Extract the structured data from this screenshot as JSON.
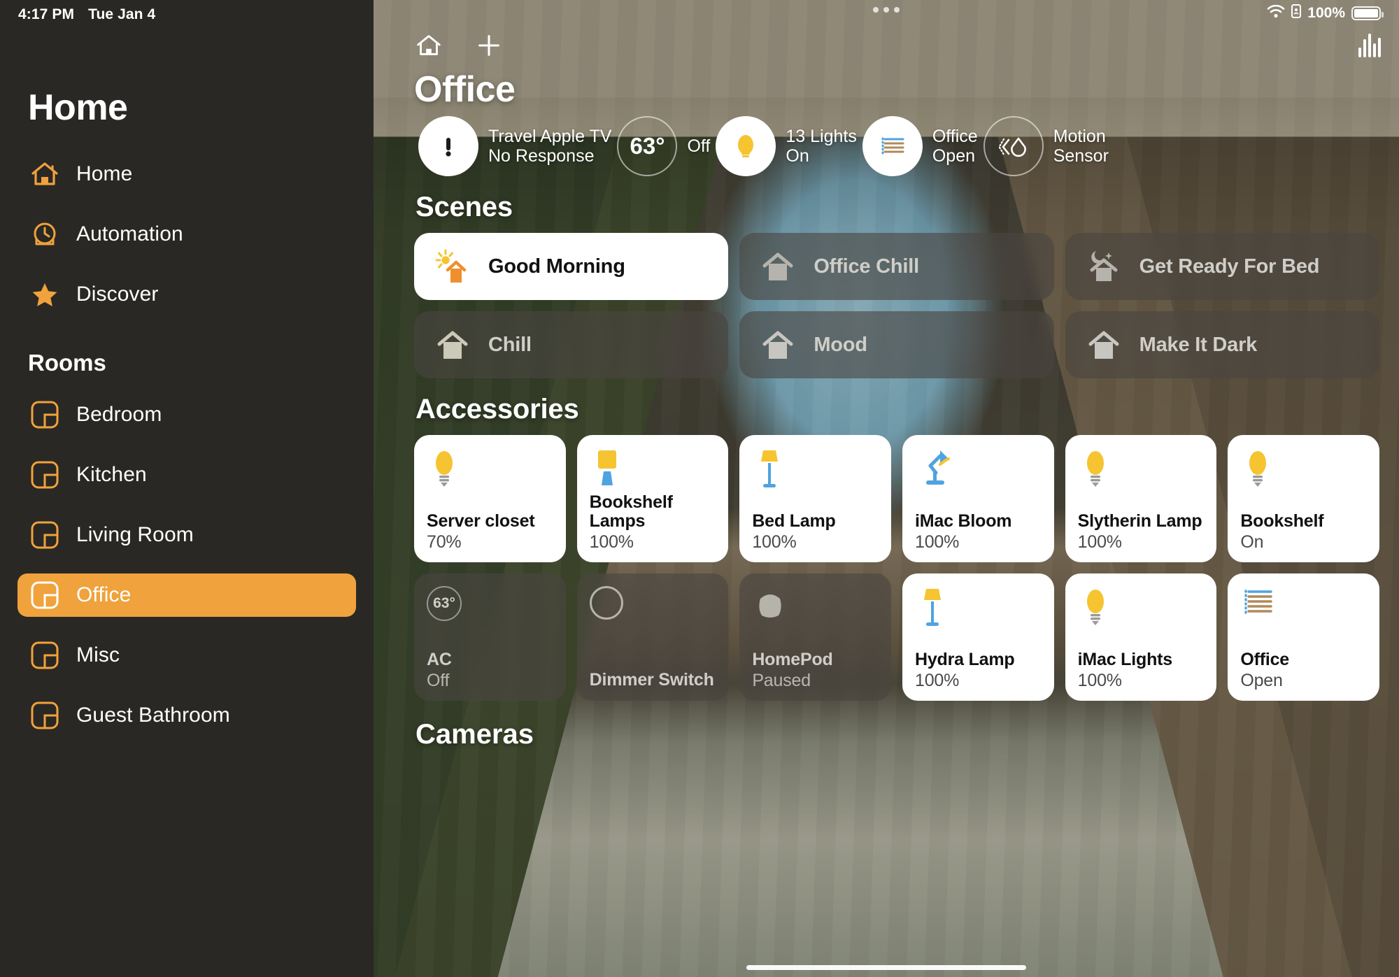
{
  "status_bar": {
    "time": "4:17 PM",
    "date": "Tue Jan 4",
    "battery_percent": "100%",
    "wifi_icon": "wifi-icon",
    "battery_icon": "battery-icon",
    "lock_icon": "portrait-lock-icon"
  },
  "sidebar": {
    "title": "Home",
    "primary": [
      {
        "label": "Home",
        "icon": "house-icon"
      },
      {
        "label": "Automation",
        "icon": "clock-icon"
      },
      {
        "label": "Discover",
        "icon": "star-icon"
      }
    ],
    "rooms_label": "Rooms",
    "rooms": [
      {
        "label": "Bedroom",
        "icon": "room-icon",
        "selected": false
      },
      {
        "label": "Kitchen",
        "icon": "room-icon",
        "selected": false
      },
      {
        "label": "Living Room",
        "icon": "room-icon",
        "selected": false
      },
      {
        "label": "Office",
        "icon": "room-icon",
        "selected": true
      },
      {
        "label": "Misc",
        "icon": "room-icon",
        "selected": false
      },
      {
        "label": "Guest Bathroom",
        "icon": "room-icon",
        "selected": false
      }
    ]
  },
  "main": {
    "home_button_icon": "house-icon",
    "add_button_icon": "plus-icon",
    "equalizer_icon": "audio-levels-icon",
    "room_title": "Office",
    "status_items": [
      {
        "icon": "exclamation-icon",
        "style": "filled",
        "line1": "Travel Apple TV",
        "line2": "No Response"
      },
      {
        "icon": "thermostat-icon",
        "style": "outline",
        "value": "63°",
        "line1": "Off",
        "line2": ""
      },
      {
        "icon": "lightbulb-icon",
        "style": "filled",
        "line1": "13 Lights",
        "line2": "On"
      },
      {
        "icon": "blinds-icon",
        "style": "filled",
        "line1": "Office",
        "line2": "Open"
      },
      {
        "icon": "motion-sensor-icon",
        "style": "outline",
        "line1": "Motion",
        "line2": "Sensor"
      }
    ],
    "scenes_title": "Scenes",
    "scenes": [
      {
        "label": "Good Morning",
        "icon": "sunrise-house-icon",
        "active": true
      },
      {
        "label": "Office Chill",
        "icon": "house-icon",
        "active": false
      },
      {
        "label": "Get Ready For Bed",
        "icon": "moon-house-icon",
        "active": false
      },
      {
        "label": "Chill",
        "icon": "house-icon",
        "active": false
      },
      {
        "label": "Mood",
        "icon": "house-icon",
        "active": false
      },
      {
        "label": "Make It Dark",
        "icon": "house-icon",
        "active": false
      }
    ],
    "accessories_title": "Accessories",
    "accessories": [
      {
        "name": "Server closet",
        "state": "70%",
        "icon": "lightbulb-icon",
        "on": true
      },
      {
        "name": "Bookshelf Lamps",
        "state": "100%",
        "icon": "table-lamp-icon",
        "on": true
      },
      {
        "name": "Bed Lamp",
        "state": "100%",
        "icon": "floor-lamp-icon",
        "on": true
      },
      {
        "name": "iMac Bloom",
        "state": "100%",
        "icon": "desk-lamp-icon",
        "on": true
      },
      {
        "name": "Slytherin Lamp",
        "state": "100%",
        "icon": "lightbulb-icon",
        "on": true
      },
      {
        "name": "Bookshelf",
        "state": "On",
        "icon": "lightbulb-icon",
        "on": true
      },
      {
        "name": "AC",
        "state": "Off",
        "icon": "thermostat-icon",
        "temp": "63°",
        "on": false
      },
      {
        "name": "Dimmer Switch",
        "state": "",
        "icon": "dimmer-switch-icon",
        "on": false
      },
      {
        "name": "HomePod",
        "state": "Paused",
        "icon": "homepod-icon",
        "on": false
      },
      {
        "name": "Hydra Lamp",
        "state": "100%",
        "icon": "floor-lamp-icon",
        "on": true
      },
      {
        "name": "iMac Lights",
        "state": "100%",
        "icon": "lightbulb-icon",
        "on": true
      },
      {
        "name": "Office",
        "state": "Open",
        "icon": "blinds-icon",
        "on": true
      }
    ],
    "cameras_title": "Cameras"
  },
  "colors": {
    "accent": "#f0a23c",
    "sidebar_bg": "#2a2824",
    "lamp_yellow": "#f5c430",
    "lamp_blue": "#4fa3e0",
    "card_white": "#ffffff"
  }
}
